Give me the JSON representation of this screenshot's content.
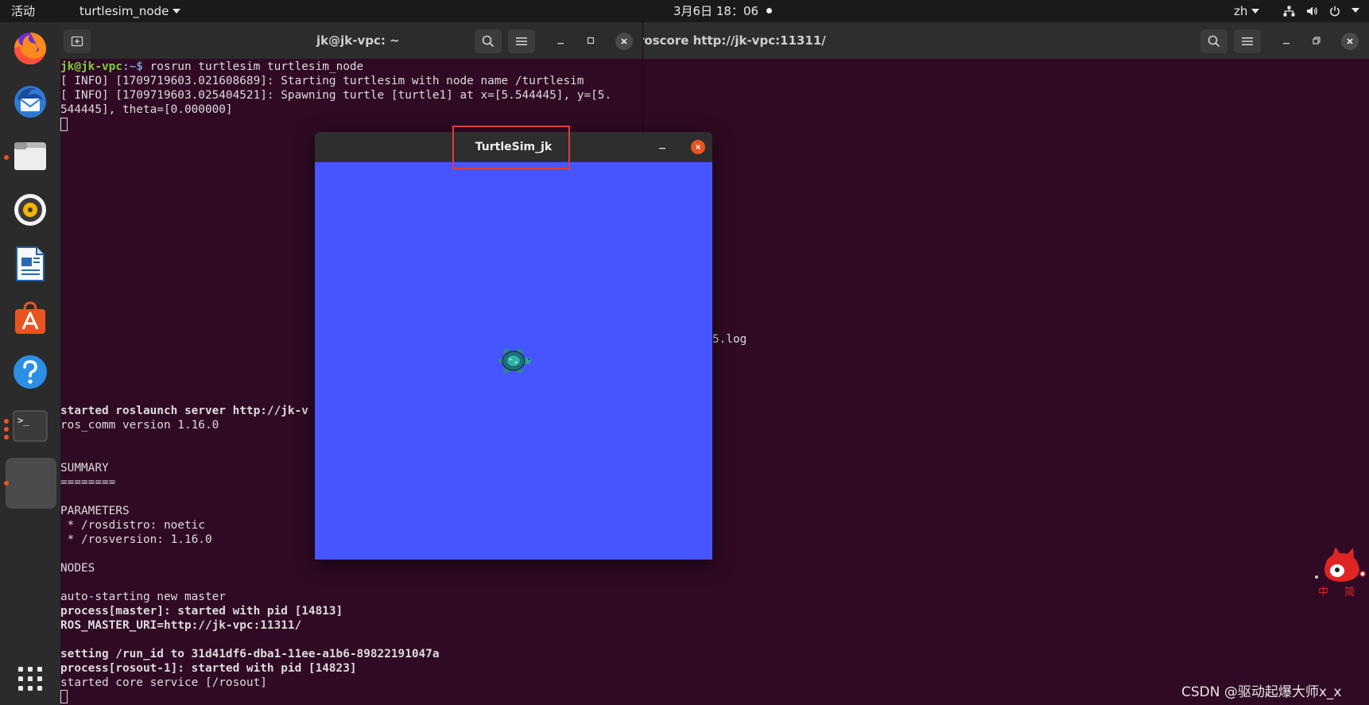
{
  "topbar": {
    "activities": "活动",
    "app_menu": "turtlesim_node",
    "clock": "3月6日  18：06",
    "input_method": "zh"
  },
  "dock": {
    "items": [
      {
        "name": "firefox-icon"
      },
      {
        "name": "thunderbird-icon"
      },
      {
        "name": "files-icon"
      },
      {
        "name": "rhythmbox-icon"
      },
      {
        "name": "writer-icon"
      },
      {
        "name": "app-center-icon"
      },
      {
        "name": "help-icon"
      },
      {
        "name": "terminal-icon",
        "glyph": ">_"
      }
    ]
  },
  "terminal_left": {
    "title": "jk@jk-vpc: ~",
    "prompt_user": "jk@jk-vpc",
    "prompt_path": ":~$ ",
    "command": "rosrun turtlesim turtlesim_node",
    "lines": [
      "[ INFO] [1709719603.021608689]: Starting turtlesim with node name /turtlesim",
      "[ INFO] [1709719603.025404521]: Spawning turtle [turtle1] at x=[5.544445], y=[5.",
      "544445], theta=[0.000000]"
    ]
  },
  "terminal_right": {
    "title": "roscore http://jk-vpc:11311/",
    "fragment_log": "5.log",
    "output": [
      {
        "text": "started roslaunch server http://jk-v",
        "bold": true
      },
      {
        "text": "ros_comm version 1.16.0",
        "bold": false
      },
      {
        "text": "",
        "bold": false
      },
      {
        "text": "",
        "bold": false
      },
      {
        "text": "SUMMARY",
        "bold": false
      },
      {
        "text": "========",
        "bold": false
      },
      {
        "text": "",
        "bold": false
      },
      {
        "text": "PARAMETERS",
        "bold": false
      },
      {
        "text": " * /rosdistro: noetic",
        "bold": false
      },
      {
        "text": " * /rosversion: 1.16.0",
        "bold": false
      },
      {
        "text": "",
        "bold": false
      },
      {
        "text": "NODES",
        "bold": false
      },
      {
        "text": "",
        "bold": false
      },
      {
        "text": "auto-starting new master",
        "bold": false
      },
      {
        "text": "process[master]: started with pid [14813]",
        "bold": true
      },
      {
        "text": "ROS_MASTER_URI=http://jk-vpc:11311/",
        "bold": true
      },
      {
        "text": "",
        "bold": false
      },
      {
        "text": "setting /run_id to 31d41df6-dba1-11ee-a1b6-89822191047a",
        "bold": true
      },
      {
        "text": "process[rosout-1]: started with pid [14823]",
        "bold": true
      },
      {
        "text": "started core service [/rosout]",
        "bold": false
      }
    ]
  },
  "turtlesim": {
    "title": "TurtleSim_jk",
    "background_color": "#4556ff",
    "turtle_x": 5.544445,
    "turtle_y": 5.544445
  },
  "mascot": {
    "caption": "中 简"
  },
  "watermark": "CSDN @驱动起爆大师x_x"
}
